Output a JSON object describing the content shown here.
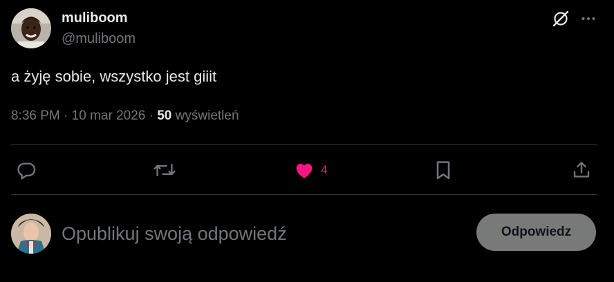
{
  "author": {
    "display_name": "muliboom",
    "handle": "@muliboom"
  },
  "header_icons": {
    "grok": "grok-icon",
    "more": "more-dots-icon"
  },
  "tweet": {
    "text": "a żyję sobie, wszystko jest giiit"
  },
  "meta": {
    "time": "8:36 PM",
    "separator": " · ",
    "date": "10 mar 2026",
    "views_count": "50",
    "views_label": "wyświetleń"
  },
  "actions": {
    "reply_icon": "reply-bubble-icon",
    "repost_icon": "repost-icon",
    "like_icon": "heart-filled-icon",
    "like_count": "4",
    "bookmark_icon": "bookmark-icon",
    "share_icon": "share-icon"
  },
  "reply_composer": {
    "placeholder": "Opublikuj swoją odpowiedź",
    "button_label": "Odpowiedz"
  },
  "colors": {
    "background": "#000000",
    "text_primary": "#e7e9ea",
    "text_secondary": "#71767b",
    "divider": "#2f3336",
    "like_active": "#f91880",
    "reply_button_bg": "#787a7a"
  }
}
